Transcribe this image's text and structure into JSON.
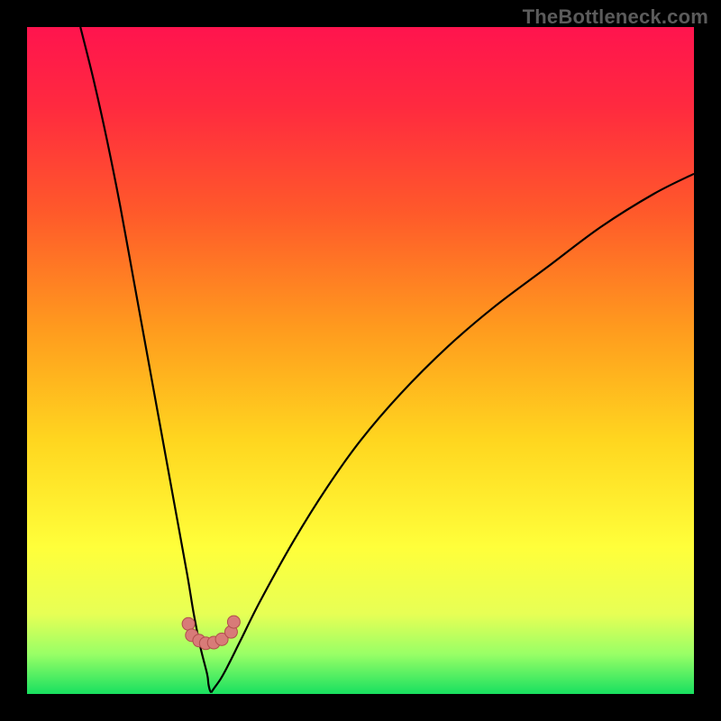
{
  "watermark": "TheBottleneck.com",
  "colors": {
    "gradient_stops": [
      {
        "offset": 0.0,
        "color": "#ff144e"
      },
      {
        "offset": 0.12,
        "color": "#ff2a3f"
      },
      {
        "offset": 0.28,
        "color": "#ff5a2a"
      },
      {
        "offset": 0.45,
        "color": "#ff9a1e"
      },
      {
        "offset": 0.62,
        "color": "#ffd61f"
      },
      {
        "offset": 0.78,
        "color": "#ffff3a"
      },
      {
        "offset": 0.88,
        "color": "#e7ff55"
      },
      {
        "offset": 0.94,
        "color": "#99ff66"
      },
      {
        "offset": 1.0,
        "color": "#18e060"
      }
    ],
    "curve": "#000000",
    "markers_fill": "#d87b78",
    "markers_stroke": "#b14f4c",
    "frame_bg": "#000000"
  },
  "chart_data": {
    "type": "line",
    "title": "",
    "xlabel": "",
    "ylabel": "",
    "xlim": [
      0,
      100
    ],
    "ylim": [
      0,
      100
    ],
    "grid": false,
    "legend": false,
    "series": [
      {
        "name": "left-branch",
        "x": [
          8,
          10,
          12,
          14,
          16,
          18,
          20,
          22,
          24,
          25,
          26,
          27,
          27.2,
          27.4,
          27.6
        ],
        "y": [
          100,
          92,
          83,
          73,
          62,
          51,
          40,
          29,
          18,
          12,
          7,
          3,
          1.5,
          0.6,
          0.2
        ]
      },
      {
        "name": "right-branch",
        "x": [
          27.6,
          28,
          29,
          30,
          32,
          35,
          40,
          45,
          50,
          56,
          63,
          70,
          78,
          86,
          94,
          100
        ],
        "y": [
          0.2,
          0.8,
          2.2,
          4,
          8,
          14,
          23,
          31,
          38,
          45,
          52,
          58,
          64,
          70,
          75,
          78
        ]
      }
    ],
    "markers": {
      "name": "bottom-cluster",
      "points": [
        {
          "x": 24.2,
          "y": 10.5
        },
        {
          "x": 24.7,
          "y": 8.8
        },
        {
          "x": 25.8,
          "y": 8.0
        },
        {
          "x": 26.8,
          "y": 7.6
        },
        {
          "x": 28.0,
          "y": 7.7
        },
        {
          "x": 29.2,
          "y": 8.2
        },
        {
          "x": 30.6,
          "y": 9.3
        },
        {
          "x": 31.0,
          "y": 10.8
        }
      ],
      "radius": 7
    }
  }
}
